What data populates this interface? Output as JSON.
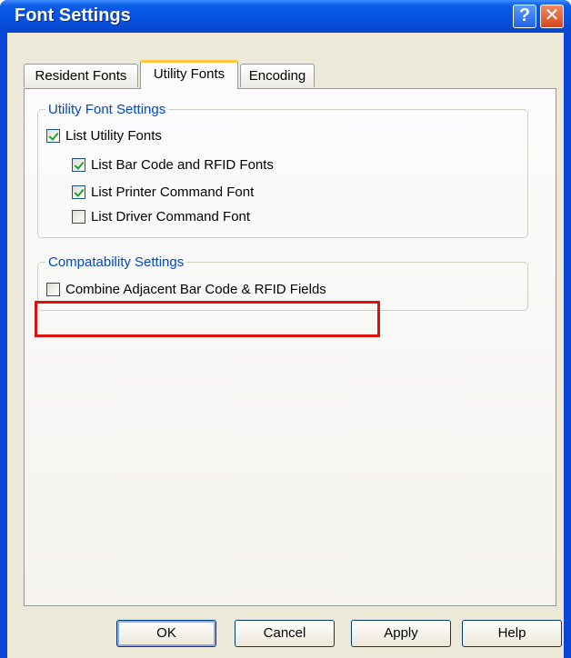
{
  "window": {
    "title": "Font Settings",
    "help_glyph": "?",
    "close_glyph": "✕"
  },
  "tabs": [
    {
      "label": "Resident Fonts",
      "active": false
    },
    {
      "label": "Utility Fonts",
      "active": true
    },
    {
      "label": "Encoding",
      "active": false
    }
  ],
  "utility_group": {
    "legend": "Utility Font Settings",
    "items": [
      {
        "label": "List Utility Fonts",
        "checked": true
      },
      {
        "label": "List Bar Code and RFID Fonts",
        "checked": true
      },
      {
        "label": "List Printer Command Font",
        "checked": true
      },
      {
        "label": "List Driver Command Font",
        "checked": false
      }
    ]
  },
  "compat_group": {
    "legend": "Compatability Settings",
    "items": [
      {
        "label": "Combine Adjacent Bar Code & RFID Fields",
        "checked": false
      }
    ]
  },
  "buttons": {
    "ok": "OK",
    "cancel": "Cancel",
    "apply": "Apply",
    "help": "Help"
  },
  "colors": {
    "titlebar": "#0553e0",
    "highlight_border": "#e01010",
    "group_legend": "#0046d5",
    "check_mark": "#21a121"
  },
  "icons": {
    "help": "help-icon",
    "close": "close-icon",
    "check": "checkmark-icon"
  }
}
